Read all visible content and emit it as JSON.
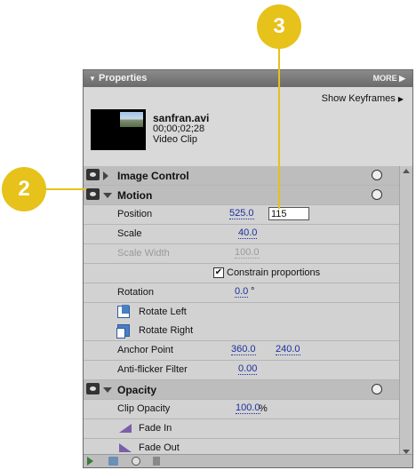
{
  "callouts": {
    "step2": "2",
    "step3": "3"
  },
  "panel": {
    "title": "Properties",
    "more_label": "MORE",
    "show_keyframes": "Show Keyframes",
    "clip": {
      "name": "sanfran.avi",
      "timecode": "00;00;02;28",
      "type": "Video Clip"
    }
  },
  "effects": {
    "image_control": {
      "label": "Image Control"
    },
    "motion": {
      "label": "Motion",
      "position": {
        "label": "Position",
        "x": "525.0",
        "y_editing": "115"
      },
      "scale": {
        "label": "Scale",
        "value": "40.0"
      },
      "scale_width": {
        "label": "Scale Width",
        "value": "100.0"
      },
      "constrain": {
        "label": "Constrain proportions",
        "checked": true
      },
      "rotation": {
        "label": "Rotation",
        "value": "0.0",
        "unit": "°"
      },
      "rotate_left": "Rotate Left",
      "rotate_right": "Rotate Right",
      "anchor_point": {
        "label": "Anchor Point",
        "x": "360.0",
        "y": "240.0"
      },
      "anti_flicker": {
        "label": "Anti-flicker Filter",
        "value": "0.00"
      }
    },
    "opacity": {
      "label": "Opacity",
      "clip_opacity": {
        "label": "Clip Opacity",
        "value": "100.0",
        "unit": "%"
      },
      "fade_in": "Fade In",
      "fade_out": "Fade Out"
    }
  },
  "colors": {
    "callout": "#e6c21a",
    "link_value": "#1a2f9e",
    "panel_bg": "#d2d2d2"
  }
}
